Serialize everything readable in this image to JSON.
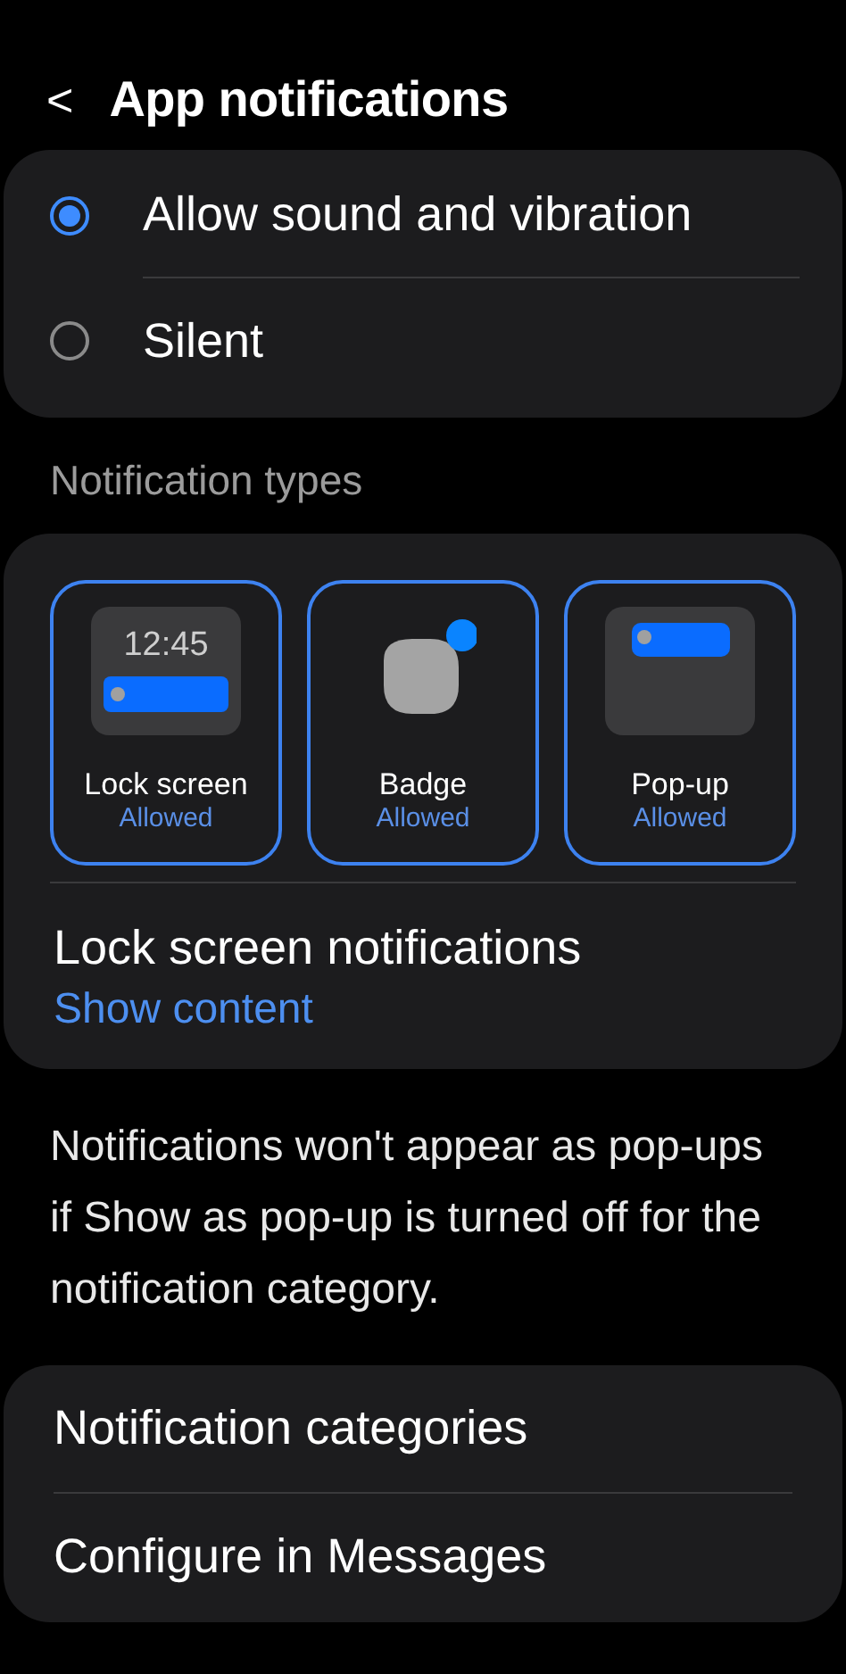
{
  "header": {
    "back": "<",
    "title": "App notifications"
  },
  "sound_options": [
    {
      "label": "Allow sound and vibration",
      "selected": true
    },
    {
      "label": "Silent",
      "selected": false
    }
  ],
  "section_label": "Notification types",
  "types": [
    {
      "kind": "lock_screen",
      "clock": "12:45",
      "label": "Lock screen",
      "status": "Allowed",
      "selected": true
    },
    {
      "kind": "badge",
      "label": "Badge",
      "status": "Allowed",
      "selected": true
    },
    {
      "kind": "popup",
      "label": "Pop-up",
      "status": "Allowed",
      "selected": true
    }
  ],
  "lock_screen_setting": {
    "title": "Lock screen notifications",
    "value": "Show content"
  },
  "info": "Notifications won't appear as pop-ups if Show as pop-up is turned off for the notification category.",
  "links": [
    "Notification categories",
    "Configure in Messages"
  ]
}
